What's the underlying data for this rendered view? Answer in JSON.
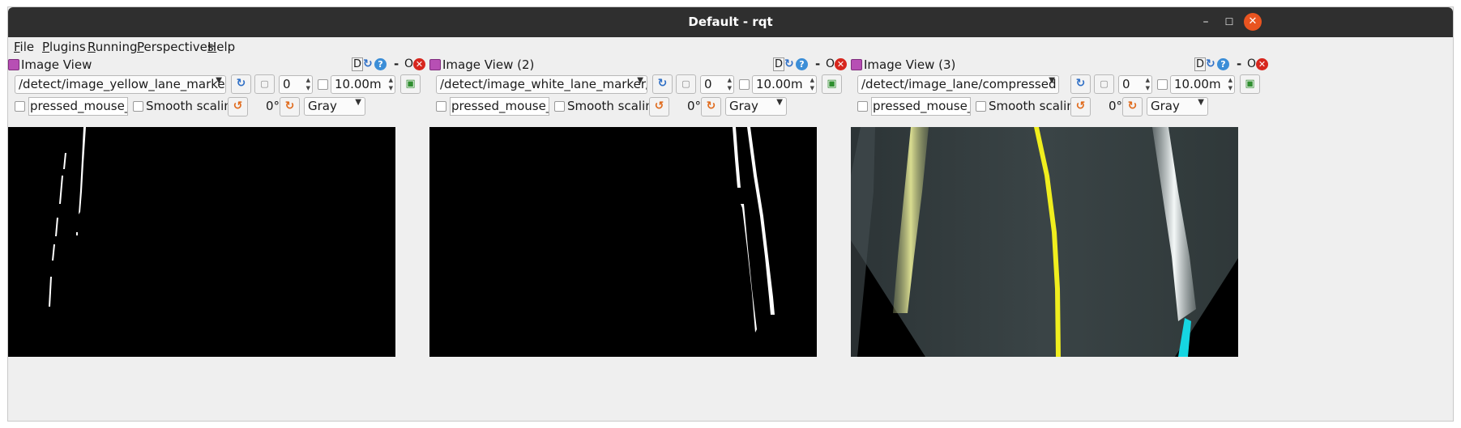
{
  "window": {
    "title": "Default - rqt"
  },
  "menu": [
    {
      "id": "file",
      "first": "F",
      "rest": "ile"
    },
    {
      "id": "plugins",
      "first": "P",
      "rest": "lugins"
    },
    {
      "id": "running",
      "first": "R",
      "rest": "unning"
    },
    {
      "id": "perspectives",
      "first": "P",
      "rest": "erspectives"
    },
    {
      "id": "help",
      "first": "H",
      "rest": "elp"
    }
  ],
  "dock_buttons": {
    "d": "D",
    "dash": "-",
    "o": "O"
  },
  "panels": [
    {
      "title": "Image View",
      "topic": "/detect/image_yellow_lane_marker/com",
      "frame": "0",
      "timeout": "10.00m",
      "mouse_topic": "pressed_mouse_left",
      "smooth_label": "Smooth scaling",
      "rotation": "0°",
      "color_scheme": "Gray"
    },
    {
      "title": "Image View (2)",
      "topic": "/detect/image_white_lane_marker/comp",
      "frame": "0",
      "timeout": "10.00m",
      "mouse_topic": "pressed_mouse_left",
      "smooth_label": "Smooth scaling",
      "rotation": "0°",
      "color_scheme": "Gray"
    },
    {
      "title": "Image View (3)",
      "topic": "/detect/image_lane/compressed",
      "frame": "0",
      "timeout": "10.00m",
      "mouse_topic": "pressed_mouse_left",
      "smooth_label": "Smooth scaling",
      "rotation": "0°",
      "color_scheme": "Gray"
    }
  ]
}
